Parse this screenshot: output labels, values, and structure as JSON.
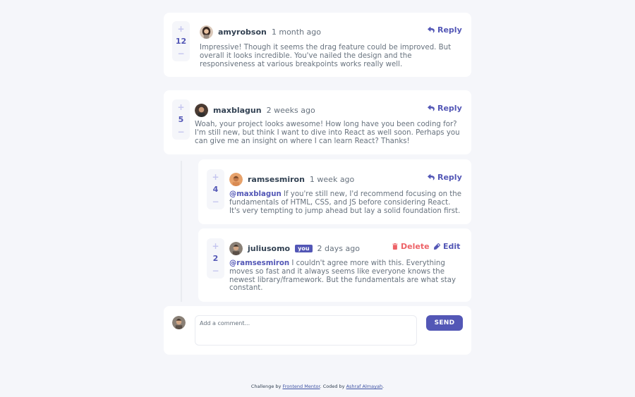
{
  "comments": [
    {
      "user": "amyrobson",
      "date": "1 month ago",
      "score": "12",
      "text": "Impressive! Though it seems the drag feature could be improved. But overall it looks incredible. You've nailed the design and the responsiveness at various breakpoints works really well.",
      "action": "Reply"
    },
    {
      "user": "maxblagun",
      "date": "2 weeks ago",
      "score": "5",
      "text": "Woah, your project looks awesome! How long have you been coding for? I'm still new, but think I want to dive into React as well soon. Perhaps you can give me an insight on where I can learn React? Thanks!",
      "action": "Reply",
      "replies": [
        {
          "user": "ramsesmiron",
          "date": "1 week ago",
          "score": "4",
          "mention": "@maxblagun",
          "text": " If you're still new, I'd recommend focusing on the fundamentals of HTML, CSS, and JS before considering React. It's very tempting to jump ahead but lay a solid foundation first.",
          "action": "Reply"
        },
        {
          "user": "juliusomo",
          "badge": "you",
          "date": "2 days ago",
          "score": "2",
          "mention": "@ramsesmiron",
          "text": " I couldn't agree more with this. Everything moves so fast and it always seems like everyone knows the newest library/framework. But the fundamentals are what stay constant.",
          "delete_label": "Delete",
          "edit_label": "Edit"
        }
      ]
    }
  ],
  "vote": {
    "plus": "+",
    "minus": "−"
  },
  "composer": {
    "placeholder": "Add a comment...",
    "send_label": "SEND"
  },
  "footer": {
    "prefix": "Challenge by ",
    "fm_link": "Frontend Mentor",
    "middle": ". Coded by ",
    "author_link": "Ashraf Almayah",
    "suffix": "."
  },
  "colors": {
    "accent": "#5357b6",
    "danger": "#ed6368",
    "background": "#f5f6fa",
    "vote_icon": "#c5c6ef"
  }
}
